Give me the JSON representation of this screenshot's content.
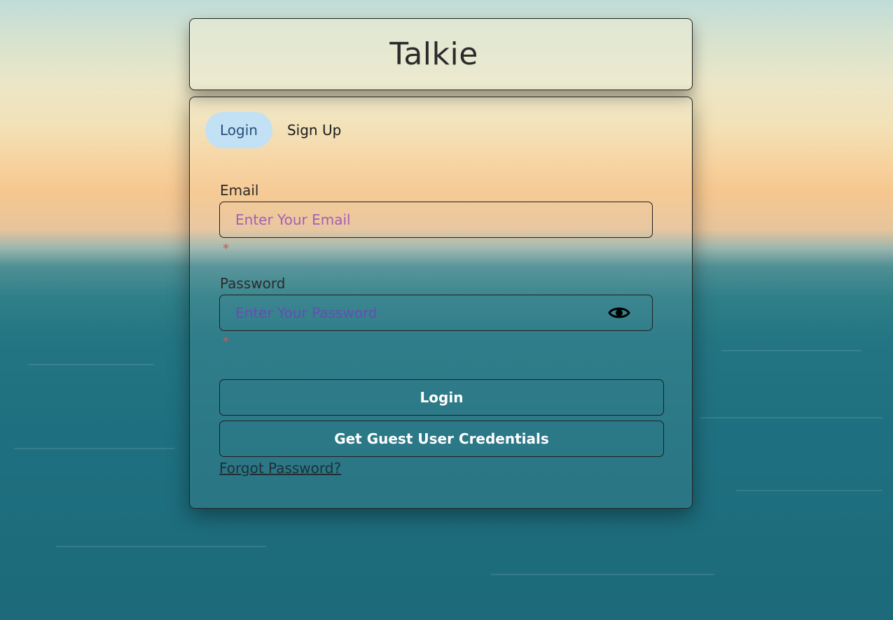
{
  "app": {
    "title": "Talkie"
  },
  "tabs": [
    {
      "label": "Login",
      "active": true
    },
    {
      "label": "Sign Up",
      "active": false
    }
  ],
  "form": {
    "email": {
      "label": "Email",
      "placeholder": "Enter Your Email",
      "value": "",
      "required_marker": "*"
    },
    "password": {
      "label": "Password",
      "placeholder": "Enter Your Password",
      "value": "",
      "required_marker": "*",
      "toggle_icon": "eye-icon"
    },
    "login_button": "Login",
    "guest_button": "Get Guest User Credentials",
    "forgot_link": "Forgot Password?"
  },
  "colors": {
    "active_tab_bg": "#c2e1f5",
    "email_placeholder": "#a45fb3",
    "password_placeholder": "#6a4bb8",
    "required": "#d9534f"
  }
}
